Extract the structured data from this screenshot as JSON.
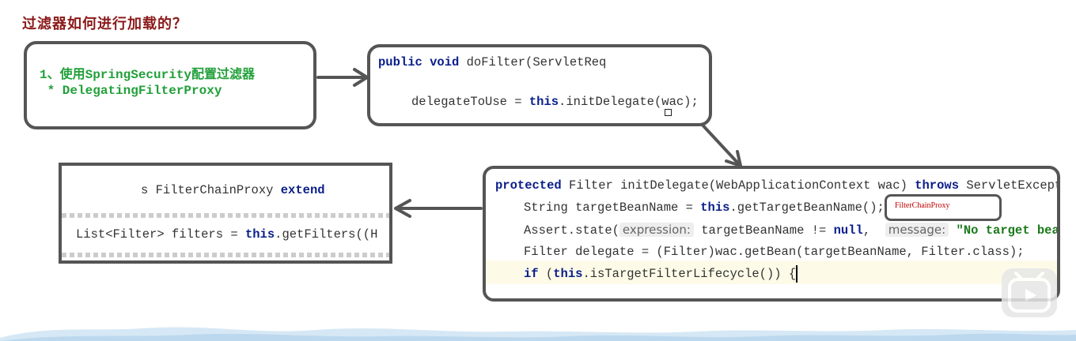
{
  "title": "过滤器如何进行加载的？",
  "box1": {
    "line1": "1、使用SpringSecurity配置过滤器",
    "line2": " * DelegatingFilterProxy"
  },
  "box2": {
    "l1_kw": "public void ",
    "l1_rest": "doFilter(ServletReq",
    "l2_a": "delegateToUse = ",
    "l2_kw": "this",
    "l2_b": ".initDelegate(wac);"
  },
  "box3": {
    "l1_a": "s FilterChainProxy ",
    "l1_kw": "extend",
    "l2_a": "List<Filter> filters = ",
    "l2_kw": "this",
    "l2_b": ".getFilters((H"
  },
  "box4": {
    "l1_kw1": "protected ",
    "l1_a": "Filter initDelegate(WebApplicationContext wac) ",
    "l1_kw2": "throws ",
    "l1_b": "ServletExcept",
    "l2_a": "String targetBeanName = ",
    "l2_kw": "this",
    "l2_b": ".getTargetBeanName();",
    "l3_a": "Assert.state(",
    "l3_hint1": "expression:",
    "l3_b": " targetBeanName != ",
    "l3_kw": "null",
    "l3_c": ",  ",
    "l3_hint2": "message:",
    "l3_str": " \"No target bea",
    "l4": "Filter delegate = (Filter)wac.getBean(targetBeanName, Filter.class);",
    "l5_kw1": "if",
    "l5_a": " (",
    "l5_kw2": "this",
    "l5_b": ".isTargetFilterLifecycle()) {"
  },
  "callout": "FilterChainProxy",
  "colors": {
    "title": "#8b1a1a",
    "green": "#22a03a",
    "keyword": "#0a1e8a",
    "border": "#555555",
    "callout_text": "#c00000"
  }
}
